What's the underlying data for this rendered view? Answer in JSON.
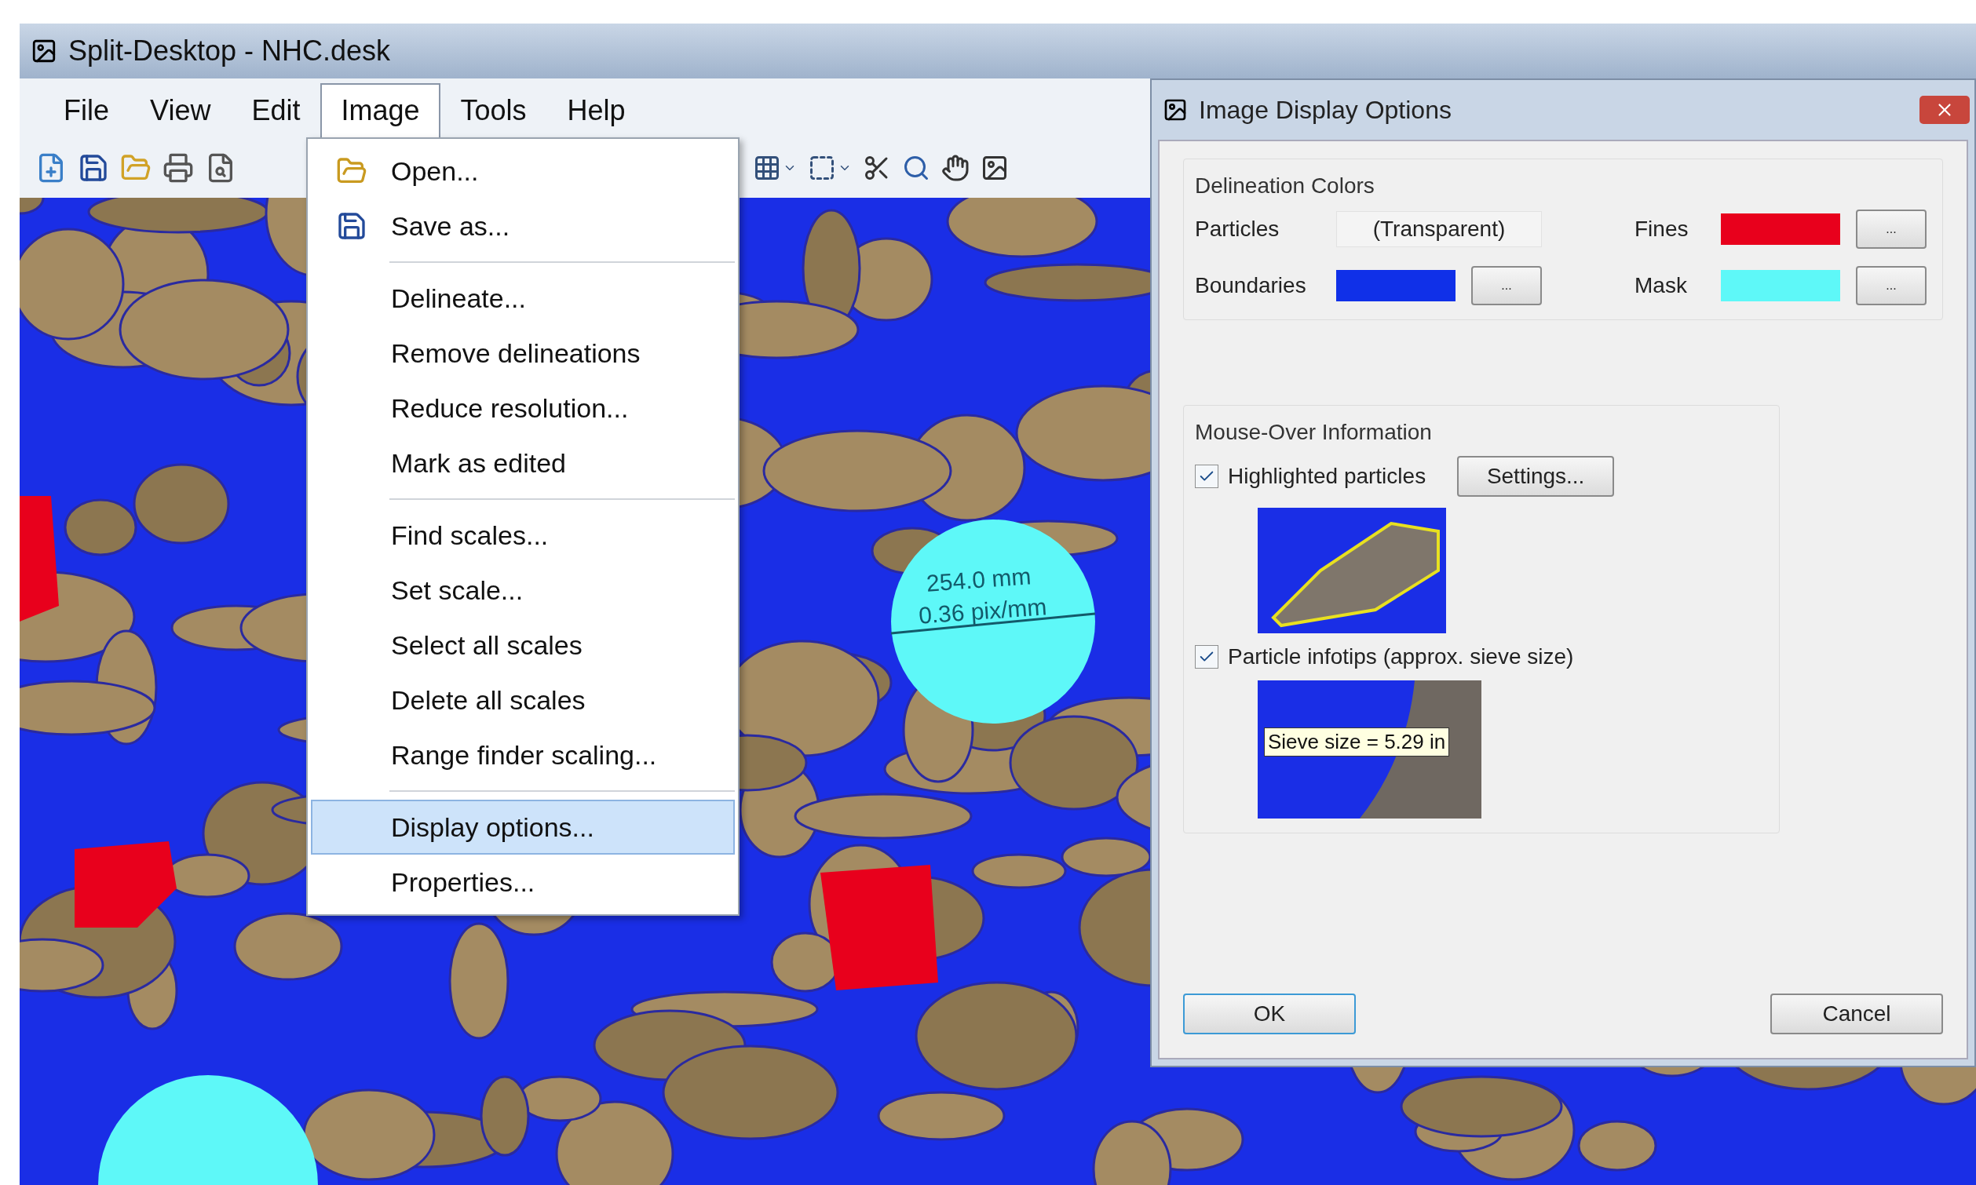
{
  "window": {
    "title": "Split-Desktop - NHC.desk"
  },
  "menu_bar": [
    {
      "label": "File",
      "selected": false
    },
    {
      "label": "View",
      "selected": false
    },
    {
      "label": "Edit",
      "selected": false
    },
    {
      "label": "Image",
      "selected": true
    },
    {
      "label": "Tools",
      "selected": false
    },
    {
      "label": "Help",
      "selected": false
    }
  ],
  "image_menu": [
    {
      "kind": "command",
      "label": "Open...",
      "has_icon": true,
      "selected": false
    },
    {
      "kind": "command",
      "label": "Save as...",
      "has_icon": true,
      "selected": false
    },
    {
      "kind": "separator"
    },
    {
      "kind": "command",
      "label": "Delineate...",
      "selected": false
    },
    {
      "kind": "command",
      "label": "Remove delineations",
      "selected": false
    },
    {
      "kind": "command",
      "label": "Reduce resolution...",
      "selected": false
    },
    {
      "kind": "command",
      "label": "Mark as edited",
      "selected": false
    },
    {
      "kind": "separator"
    },
    {
      "kind": "command",
      "label": "Find scales...",
      "selected": false
    },
    {
      "kind": "command",
      "label": "Set scale...",
      "selected": false
    },
    {
      "kind": "command",
      "label": "Select all scales",
      "selected": false
    },
    {
      "kind": "command",
      "label": "Delete all scales",
      "selected": false
    },
    {
      "kind": "command",
      "label": "Range finder scaling...",
      "selected": false
    },
    {
      "kind": "separator"
    },
    {
      "kind": "command",
      "label": "Display options...",
      "selected": true
    },
    {
      "kind": "command",
      "label": "Properties...",
      "selected": false
    }
  ],
  "scale_marker": {
    "length": "254.0 mm",
    "resolution": "0.36 pix/mm"
  },
  "dialog": {
    "title": "Image Display Options",
    "delineation_colors": {
      "title": "Delineation Colors",
      "entries": [
        {
          "kind": "text",
          "label": "Particles",
          "value": "(Transparent)"
        },
        {
          "kind": "color",
          "label": "Fines",
          "color": "#e8001c",
          "button": "..."
        },
        {
          "kind": "color",
          "label": "Boundaries",
          "color": "#1030e8",
          "button": "..."
        },
        {
          "kind": "color",
          "label": "Mask",
          "color": "#5ef8f8",
          "button": "..."
        }
      ]
    },
    "mouse_over": {
      "title": "Mouse-Over Information",
      "options": [
        {
          "kind": "highlight",
          "label": "Highlighted particles",
          "checked": true,
          "button": "Settings..."
        },
        {
          "kind": "infotip",
          "label": "Particle infotips (approx. sieve size)",
          "checked": true,
          "tip": "Sieve size = 5.29 in"
        }
      ]
    },
    "buttons": [
      {
        "label": "OK",
        "selected": true
      },
      {
        "label": "Cancel",
        "selected": false
      }
    ]
  }
}
